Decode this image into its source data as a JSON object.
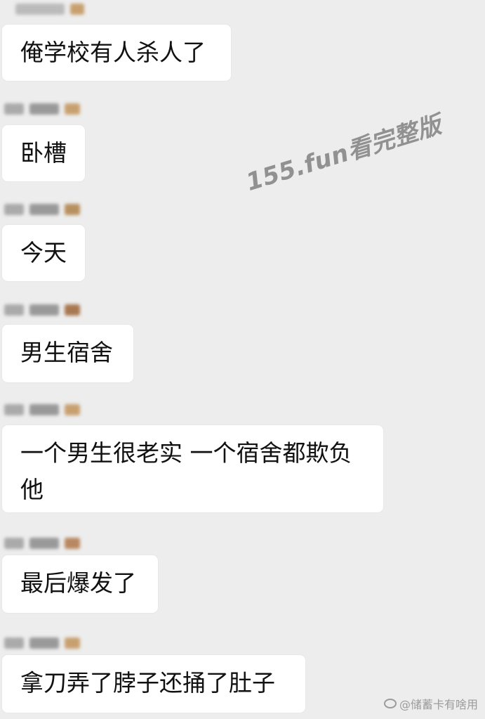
{
  "messages": [
    {
      "text": "俺学校有人杀人了"
    },
    {
      "text": "卧槽"
    },
    {
      "text": "今天"
    },
    {
      "text": "男生宿舍"
    },
    {
      "text": "一个男生很老实 一个宿舍都欺负他"
    },
    {
      "text": "最后爆发了"
    },
    {
      "text": "拿刀弄了脖子还捅了肚子"
    }
  ],
  "watermark": "155.fun看完整版",
  "weibo_watermark": "@储蓄卡有啥用",
  "colors": {
    "background": "#ededed",
    "bubble": "#ffffff",
    "text": "#111111"
  }
}
